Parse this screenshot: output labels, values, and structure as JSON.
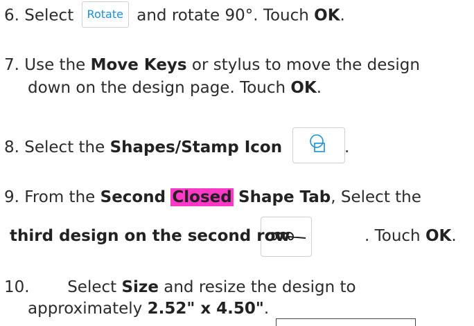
{
  "step6": {
    "number": "6.",
    "pre": "Select",
    "button": "Rotate",
    "mid": "and rotate 90°. Touch",
    "ok": "OK",
    "end": "."
  },
  "step7": {
    "number": "7.",
    "pre": "Use the",
    "bold1": "Move Keys",
    "mid": "or stylus to move the design",
    "line2": "down on the design page. Touch",
    "ok": "OK",
    "end": "."
  },
  "step8": {
    "number": "8.",
    "pre": "Select the",
    "bold1": "Shapes/Stamp Icon",
    "end": ".",
    "icon": "shapes-stamp-icon"
  },
  "step9": {
    "number": "9.",
    "pre": "From the",
    "bold1": "Second",
    "highlight": "Closed",
    "bold2": "Shape Tab",
    "mid": ", Select the",
    "line2_bold": "third design on the second row",
    "line2_mid": ". Touch",
    "ok": "OK",
    "end": ".",
    "icon": "loop-design-icon",
    "highlight_color": "#ff38c8"
  },
  "step10": {
    "number": "10.",
    "pre": "Select",
    "bold1": "Size",
    "mid": "and resize the design to",
    "line2": "approximately",
    "bold2": "2.52\" x 4.50\"",
    "end": "."
  }
}
